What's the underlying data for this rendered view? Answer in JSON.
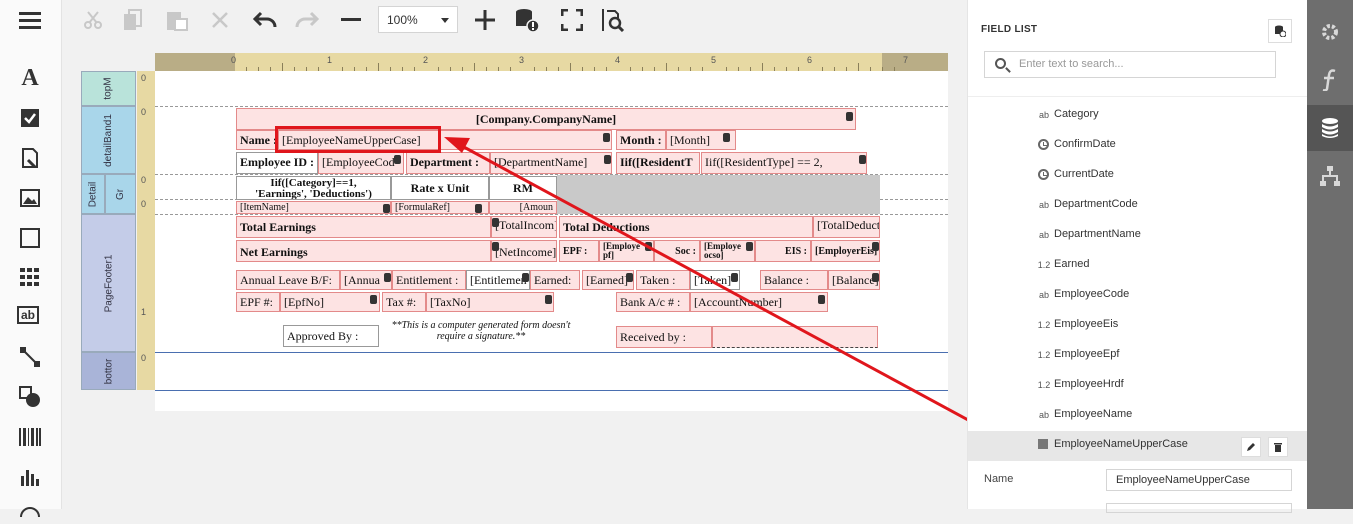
{
  "toolbar": {
    "zoom_value": "100%",
    "icons": [
      "cut-icon",
      "copy-icon",
      "paste-icon",
      "delete-icon",
      "undo-icon",
      "redo-icon",
      "zoom-out-icon",
      "zoom-in-icon",
      "validate-bindings-icon",
      "full-screen-icon",
      "preview-icon"
    ]
  },
  "toolbox": {
    "icons": [
      "menu-icon",
      "label-icon",
      "checkbox-icon",
      "rich-text-icon",
      "picture-icon",
      "panel-icon",
      "table-icon",
      "character-comb-icon",
      "line-icon",
      "shape-icon",
      "barcode-icon",
      "chart-icon",
      "gauge-icon"
    ],
    "label_glyph": "A",
    "charcomb_glyph": "ab"
  },
  "ruler": {
    "marks": [
      "0",
      "1",
      "2",
      "3",
      "4",
      "5",
      "6",
      "7"
    ],
    "left_marks": [
      "0",
      "0",
      "0",
      "0",
      "1",
      "0"
    ]
  },
  "bands": {
    "top": "topM",
    "detail1": "detailBand1",
    "detail2": "Detail",
    "group": "Gr",
    "footer": "PageFooter1",
    "bottom": "bottor"
  },
  "report": {
    "company": "[Company.CompanyName]",
    "name_label": "Name :",
    "name_field": "[EmployeeNameUpperCase]",
    "month_label": "Month :",
    "month_field": "[Month]",
    "empid_label": "Employee ID :",
    "empid_field": "[EmployeeCod",
    "dept_label": "Department :",
    "dept_field": "[DepartmentName]",
    "resident1": "Iif([ResidentT",
    "resident2": "Iif([ResidentType] == 2,",
    "category_hdr": "Iif([Category]==1,",
    "category_hdr2": "'Earnings', 'Deductions')",
    "rate_hdr": "Rate x Unit",
    "rm_hdr": "RM",
    "item_name": "[ItemName]",
    "formula_ref": "[FormulaRef]",
    "amount": "[Amoun",
    "total_earnings": "Total Earnings",
    "total_income": "[TotalIncom]",
    "total_deductions": "Total Deductions",
    "total_deduct": "[TotalDeduct]",
    "net_earnings": "Net Earnings",
    "net_income": "[NetIncome]",
    "epf": "EPF :",
    "employee_epf": "[Employe pf]",
    "soc": "Soc :",
    "employee_socso": "[Employe ocso]",
    "eis": "EIS :",
    "employer_eis": "[EmployerEis]",
    "annual_leave": "Annual Leave B/F:",
    "annual_field": "[Annua",
    "entitlement": "Entitlement :",
    "entitlement_field": "[Entitlemen",
    "earned": "Earned:",
    "earned_field": "[Earned]",
    "taken": "Taken :",
    "taken_field": "[Taken]",
    "balance": "Balance :",
    "balance_field": "[Balance]",
    "epf_no_label": "EPF #:",
    "epf_no": "[EpfNo]",
    "tax_label": "Tax #:",
    "tax_no": "[TaxNo]",
    "bank_label": "Bank A/c # :",
    "account_no": "[AccountNumber]",
    "approved_by": "Approved By :",
    "note": "**This is a computer generated form doesn't require a signature.**",
    "received_by": "Received by :"
  },
  "field_list": {
    "title": "FIELD LIST",
    "search_placeholder": "Enter text to search...",
    "items": [
      {
        "name": "Category",
        "type": "ab"
      },
      {
        "name": "ConfirmDate",
        "type": "date"
      },
      {
        "name": "CurrentDate",
        "type": "date"
      },
      {
        "name": "DepartmentCode",
        "type": "ab"
      },
      {
        "name": "DepartmentName",
        "type": "ab"
      },
      {
        "name": "Earned",
        "type": "1.2"
      },
      {
        "name": "EmployeeCode",
        "type": "ab"
      },
      {
        "name": "EmployeeEis",
        "type": "1.2"
      },
      {
        "name": "EmployeeEpf",
        "type": "1.2"
      },
      {
        "name": "EmployeeHrdf",
        "type": "1.2"
      },
      {
        "name": "EmployeeName",
        "type": "ab"
      },
      {
        "name": "EmployeeNameUpperCase",
        "type": "calc"
      }
    ],
    "selected": "EmployeeNameUpperCase"
  },
  "properties": {
    "name_label": "Name",
    "name_value": "EmployeeNameUpperCase"
  },
  "side_tabs": [
    "properties-tab",
    "expressions-tab",
    "field-list-tab",
    "report-explorer-tab"
  ],
  "colors": {
    "highlight": "#e0161c",
    "field_bg": "#fde3e3",
    "band_top": "#b9e3da",
    "band_detail": "#a9d6ea",
    "band_footer": "#c4cce8",
    "band_bottom": "#a9b4d8"
  }
}
